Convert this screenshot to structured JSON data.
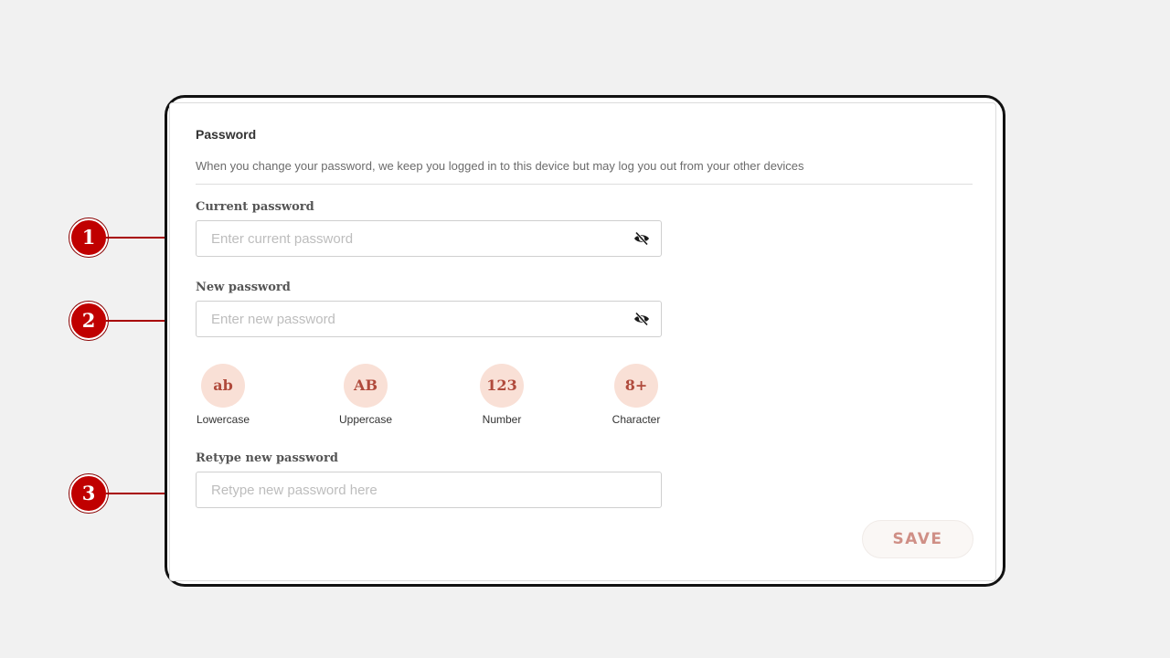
{
  "section": {
    "title": "Password",
    "description": "When you change your password, we keep you logged in to this device but may log you out from your other devices"
  },
  "fields": {
    "current": {
      "label": "Current password",
      "placeholder": "Enter current password",
      "value": ""
    },
    "new": {
      "label": "New password",
      "placeholder": "Enter new password",
      "value": ""
    },
    "retype": {
      "label": "Retype new password",
      "placeholder": "Retype new password here",
      "value": ""
    }
  },
  "requirements": [
    {
      "symbol": "ab",
      "label": "Lowercase"
    },
    {
      "symbol": "AB",
      "label": "Uppercase"
    },
    {
      "symbol": "123",
      "label": "Number"
    },
    {
      "symbol": "8+",
      "label": "Character"
    }
  ],
  "save_label": "SAVE",
  "callouts": [
    "1",
    "2",
    "3"
  ],
  "icons": {
    "visibility_toggle": "eye-off-icon"
  },
  "colors": {
    "callout": "#c00000",
    "requirement_bg": "#f9e0d6",
    "requirement_text": "#b04a3c",
    "save_text": "#cf8f86"
  }
}
